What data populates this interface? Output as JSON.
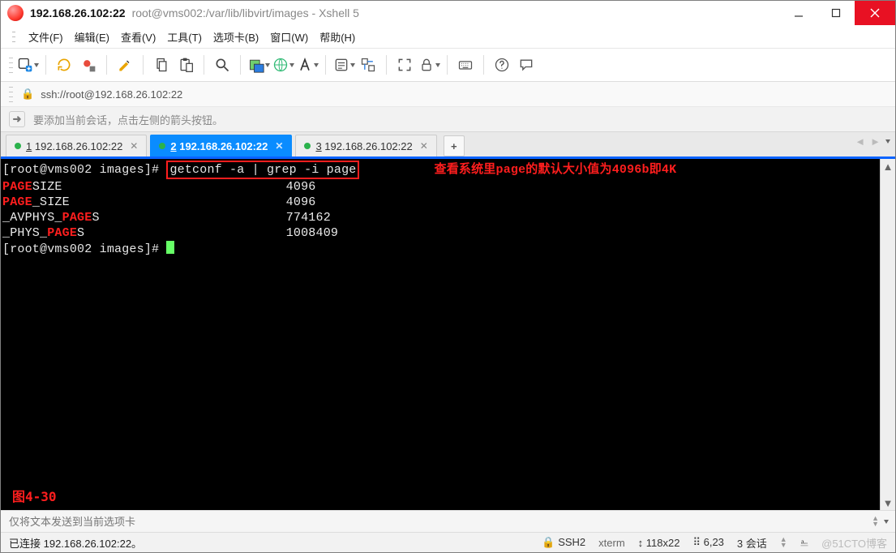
{
  "titlebar": {
    "main": "192.168.26.102:22",
    "rest": "root@vms002:/var/lib/libvirt/images - Xshell 5"
  },
  "menubar": {
    "items": [
      "文件(F)",
      "编辑(E)",
      "查看(V)",
      "工具(T)",
      "选项卡(B)",
      "窗口(W)",
      "帮助(H)"
    ]
  },
  "address": {
    "url": "ssh://root@192.168.26.102:22"
  },
  "info": {
    "text": "要添加当前会话，点击左侧的箭头按钮。"
  },
  "tabs": {
    "items": [
      {
        "num": "1",
        "label": "192.168.26.102:22",
        "active": false
      },
      {
        "num": "2",
        "label": "192.168.26.102:22",
        "active": true
      },
      {
        "num": "3",
        "label": "192.168.26.102:22",
        "active": false
      }
    ]
  },
  "terminal": {
    "prompt1": "[root@vms002 images]#",
    "command": "getconf -a | grep -i page",
    "annotation": "查看系统里page的默认大小值为4096b即4K",
    "rows": [
      {
        "hl": "PAGE",
        "rest": "SIZE",
        "val": "4096"
      },
      {
        "hl": "PAGE",
        "rest": "_SIZE",
        "pre": "",
        "val": "4096"
      },
      {
        "pre": "_AVPHYS_",
        "hl": "PAGE",
        "rest": "S",
        "val": "774162"
      },
      {
        "pre": "_PHYS_",
        "hl": "PAGE",
        "rest": "S",
        "val": "1008409"
      }
    ],
    "prompt2": "[root@vms002 images]#",
    "fig": "图4-30"
  },
  "send": {
    "placeholder": "仅将文本发送到当前选项卡"
  },
  "statusbar": {
    "left": "已连接 192.168.26.102:22。",
    "ssh": "SSH2",
    "term": "xterm",
    "size": "118x22",
    "cursor": "6,23",
    "sess_label": "会话",
    "sess_count": "3",
    "watermark": "@51CTO博客"
  }
}
